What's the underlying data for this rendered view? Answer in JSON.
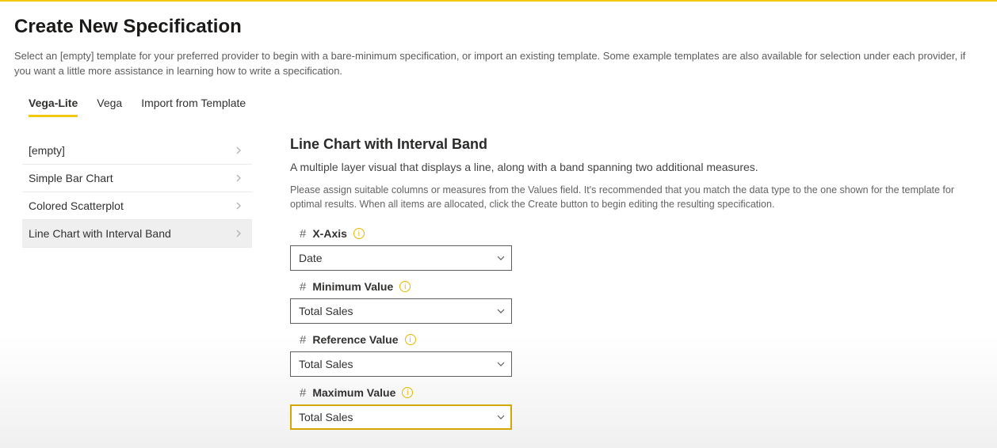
{
  "page": {
    "title": "Create New Specification",
    "intro": "Select an [empty] template for your preferred provider to begin with a bare-minimum specification, or import an existing template. Some example templates are also available for selection under each provider, if you want a little more assistance in learning how to write a specification."
  },
  "tabs": {
    "vegaLite": "Vega-Lite",
    "vega": "Vega",
    "import": "Import from Template"
  },
  "templates": {
    "empty": "[empty]",
    "bar": "Simple Bar Chart",
    "scatter": "Colored Scatterplot",
    "lineBand": "Line Chart with Interval Band"
  },
  "detail": {
    "title": "Line Chart with Interval Band",
    "desc": "A multiple layer visual that displays a line, along with a band spanning two additional measures.",
    "help": "Please assign suitable columns or measures from the Values field. It's recommended that you match the data type to the one shown for the template for optimal results. When all items are allocated, click the Create button to begin editing the resulting specification."
  },
  "fields": {
    "xaxis": {
      "label": "X-Axis",
      "value": "Date"
    },
    "min": {
      "label": "Minimum Value",
      "value": "Total Sales"
    },
    "ref": {
      "label": "Reference Value",
      "value": "Total Sales"
    },
    "max": {
      "label": "Maximum Value",
      "value": "Total Sales"
    }
  }
}
